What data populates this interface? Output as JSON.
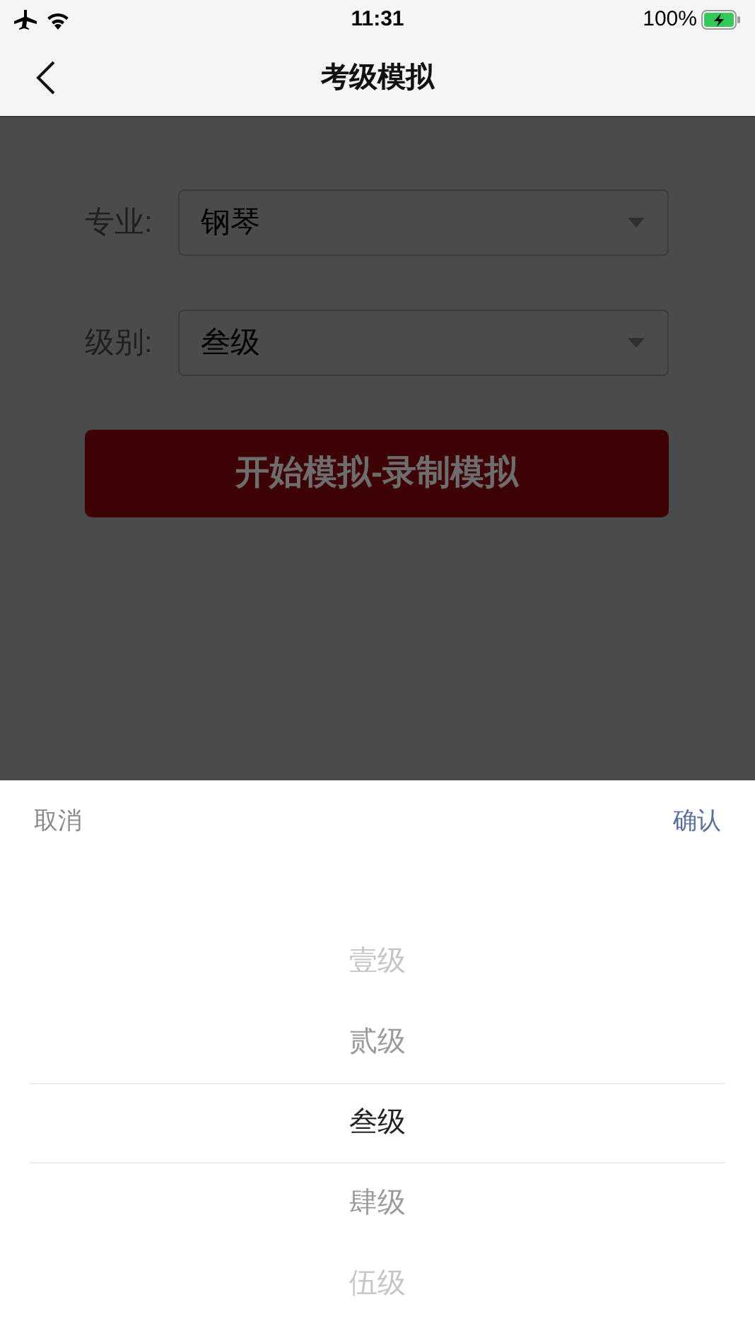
{
  "status_bar": {
    "time": "11:31",
    "battery": "100%"
  },
  "nav": {
    "title": "考级模拟"
  },
  "form": {
    "fields": [
      {
        "label": "专业:",
        "value": "钢琴"
      },
      {
        "label": "级别:",
        "value": "叁级"
      }
    ],
    "button": "开始模拟-录制模拟"
  },
  "picker": {
    "cancel": "取消",
    "confirm": "确认",
    "options": [
      {
        "label": "壹级",
        "selected": false
      },
      {
        "label": "贰级",
        "selected": false
      },
      {
        "label": "叁级",
        "selected": true
      },
      {
        "label": "肆级",
        "selected": false
      },
      {
        "label": "伍级",
        "selected": false
      }
    ]
  }
}
